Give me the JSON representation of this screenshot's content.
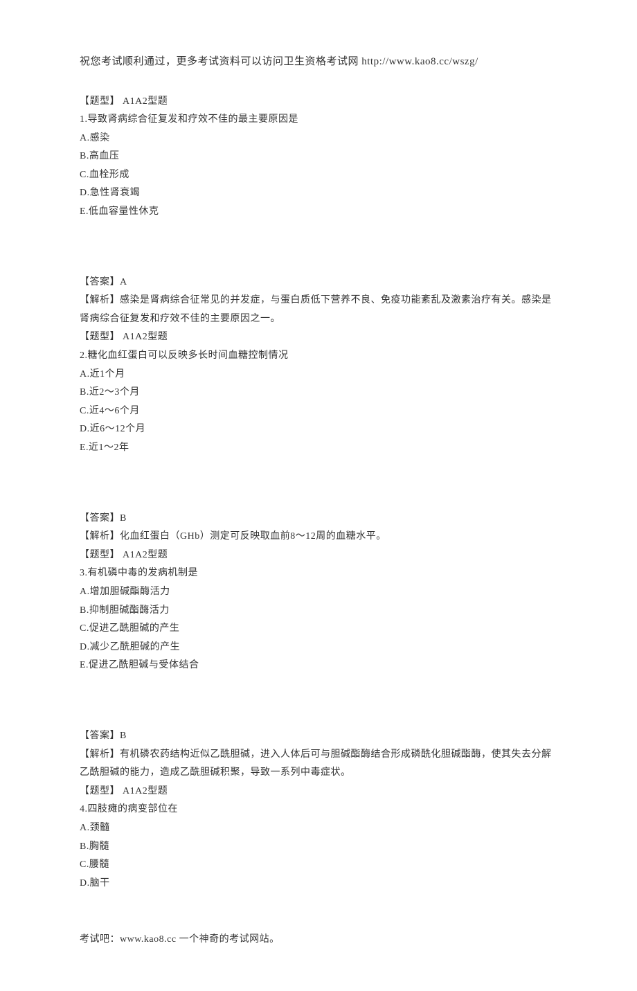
{
  "header": "祝您考试顺利通过，更多考试资料可以访问卫生资格考试网 http://www.kao8.cc/wszg/",
  "questions": [
    {
      "type": "【题型】 A1A2型题",
      "stem": "1.导致肾病综合征复发和疗效不佳的最主要原因是",
      "options": [
        "A.感染",
        "B.高血压",
        "C.血栓形成",
        "D.急性肾衰竭",
        "E.低血容量性休克"
      ],
      "answer": "【答案】A",
      "analysis": "【解析】感染是肾病综合征常见的并发症，与蛋白质低下营养不良、免疫功能紊乱及激素治疗有关。感染是肾病综合征复发和疗效不佳的主要原因之一。"
    },
    {
      "type": "【题型】 A1A2型题",
      "stem": "2.糖化血红蛋白可以反映多长时间血糖控制情况",
      "options": [
        "A.近1个月",
        "B.近2～3个月",
        "C.近4～6个月",
        "D.近6～12个月",
        "E.近1～2年"
      ],
      "answer": "【答案】B",
      "analysis": "【解析】化血红蛋白（GHb）测定可反映取血前8～12周的血糖水平。"
    },
    {
      "type": "【题型】 A1A2型题",
      "stem": "3.有机磷中毒的发病机制是",
      "options": [
        "A.增加胆碱酯酶活力",
        "B.抑制胆碱酯酶活力",
        "C.促进乙酰胆碱的产生",
        "D.减少乙酰胆碱的产生",
        "E.促进乙酰胆碱与受体结合"
      ],
      "answer": "【答案】B",
      "analysis": "【解析】有机磷农药结构近似乙酰胆碱，进入人体后可与胆碱酯酶结合形成磷酰化胆碱酯酶，使其失去分解乙酰胆碱的能力，造成乙酰胆碱积聚，导致一系列中毒症状。"
    },
    {
      "type": "【题型】 A1A2型题",
      "stem": "4.四肢瘫的病变部位在",
      "options": [
        "A.颈髓",
        "B.胸髓",
        "C.腰髓",
        "D.脑干"
      ],
      "answer": "",
      "analysis": ""
    }
  ],
  "footer": "考试吧：www.kao8.cc 一个神奇的考试网站。"
}
